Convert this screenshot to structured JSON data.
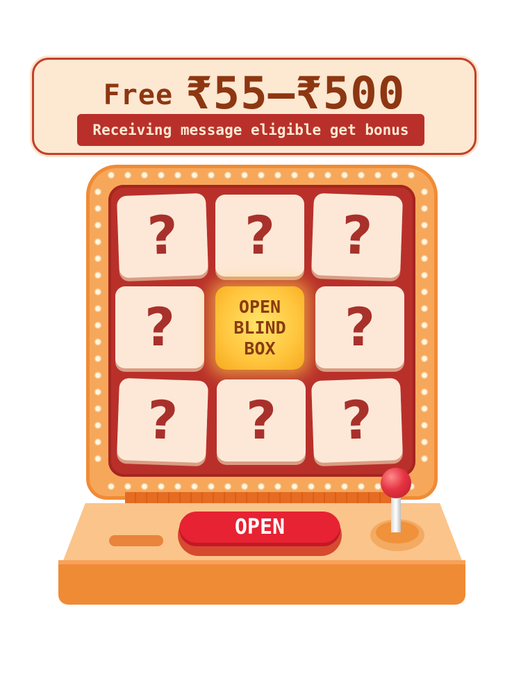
{
  "banner": {
    "free_label": "Free",
    "amount_range": "₹55–₹500",
    "subtitle": "Receiving message eligible get bonus"
  },
  "grid": {
    "cells": [
      "?",
      "?",
      "?",
      "?",
      "?",
      "?",
      "?",
      "?"
    ],
    "center_lines": [
      "OPEN",
      "BLIND",
      "BOX"
    ]
  },
  "controls": {
    "open_button_label": "OPEN",
    "joystick": "joystick-icon"
  },
  "colors": {
    "banner_bg": "#fde8d2",
    "screen_red": "#b9302a",
    "cabinet_orange": "#f7a75a",
    "open_button_red": "#e62233",
    "highlight_yellow": "#ffc53d"
  }
}
